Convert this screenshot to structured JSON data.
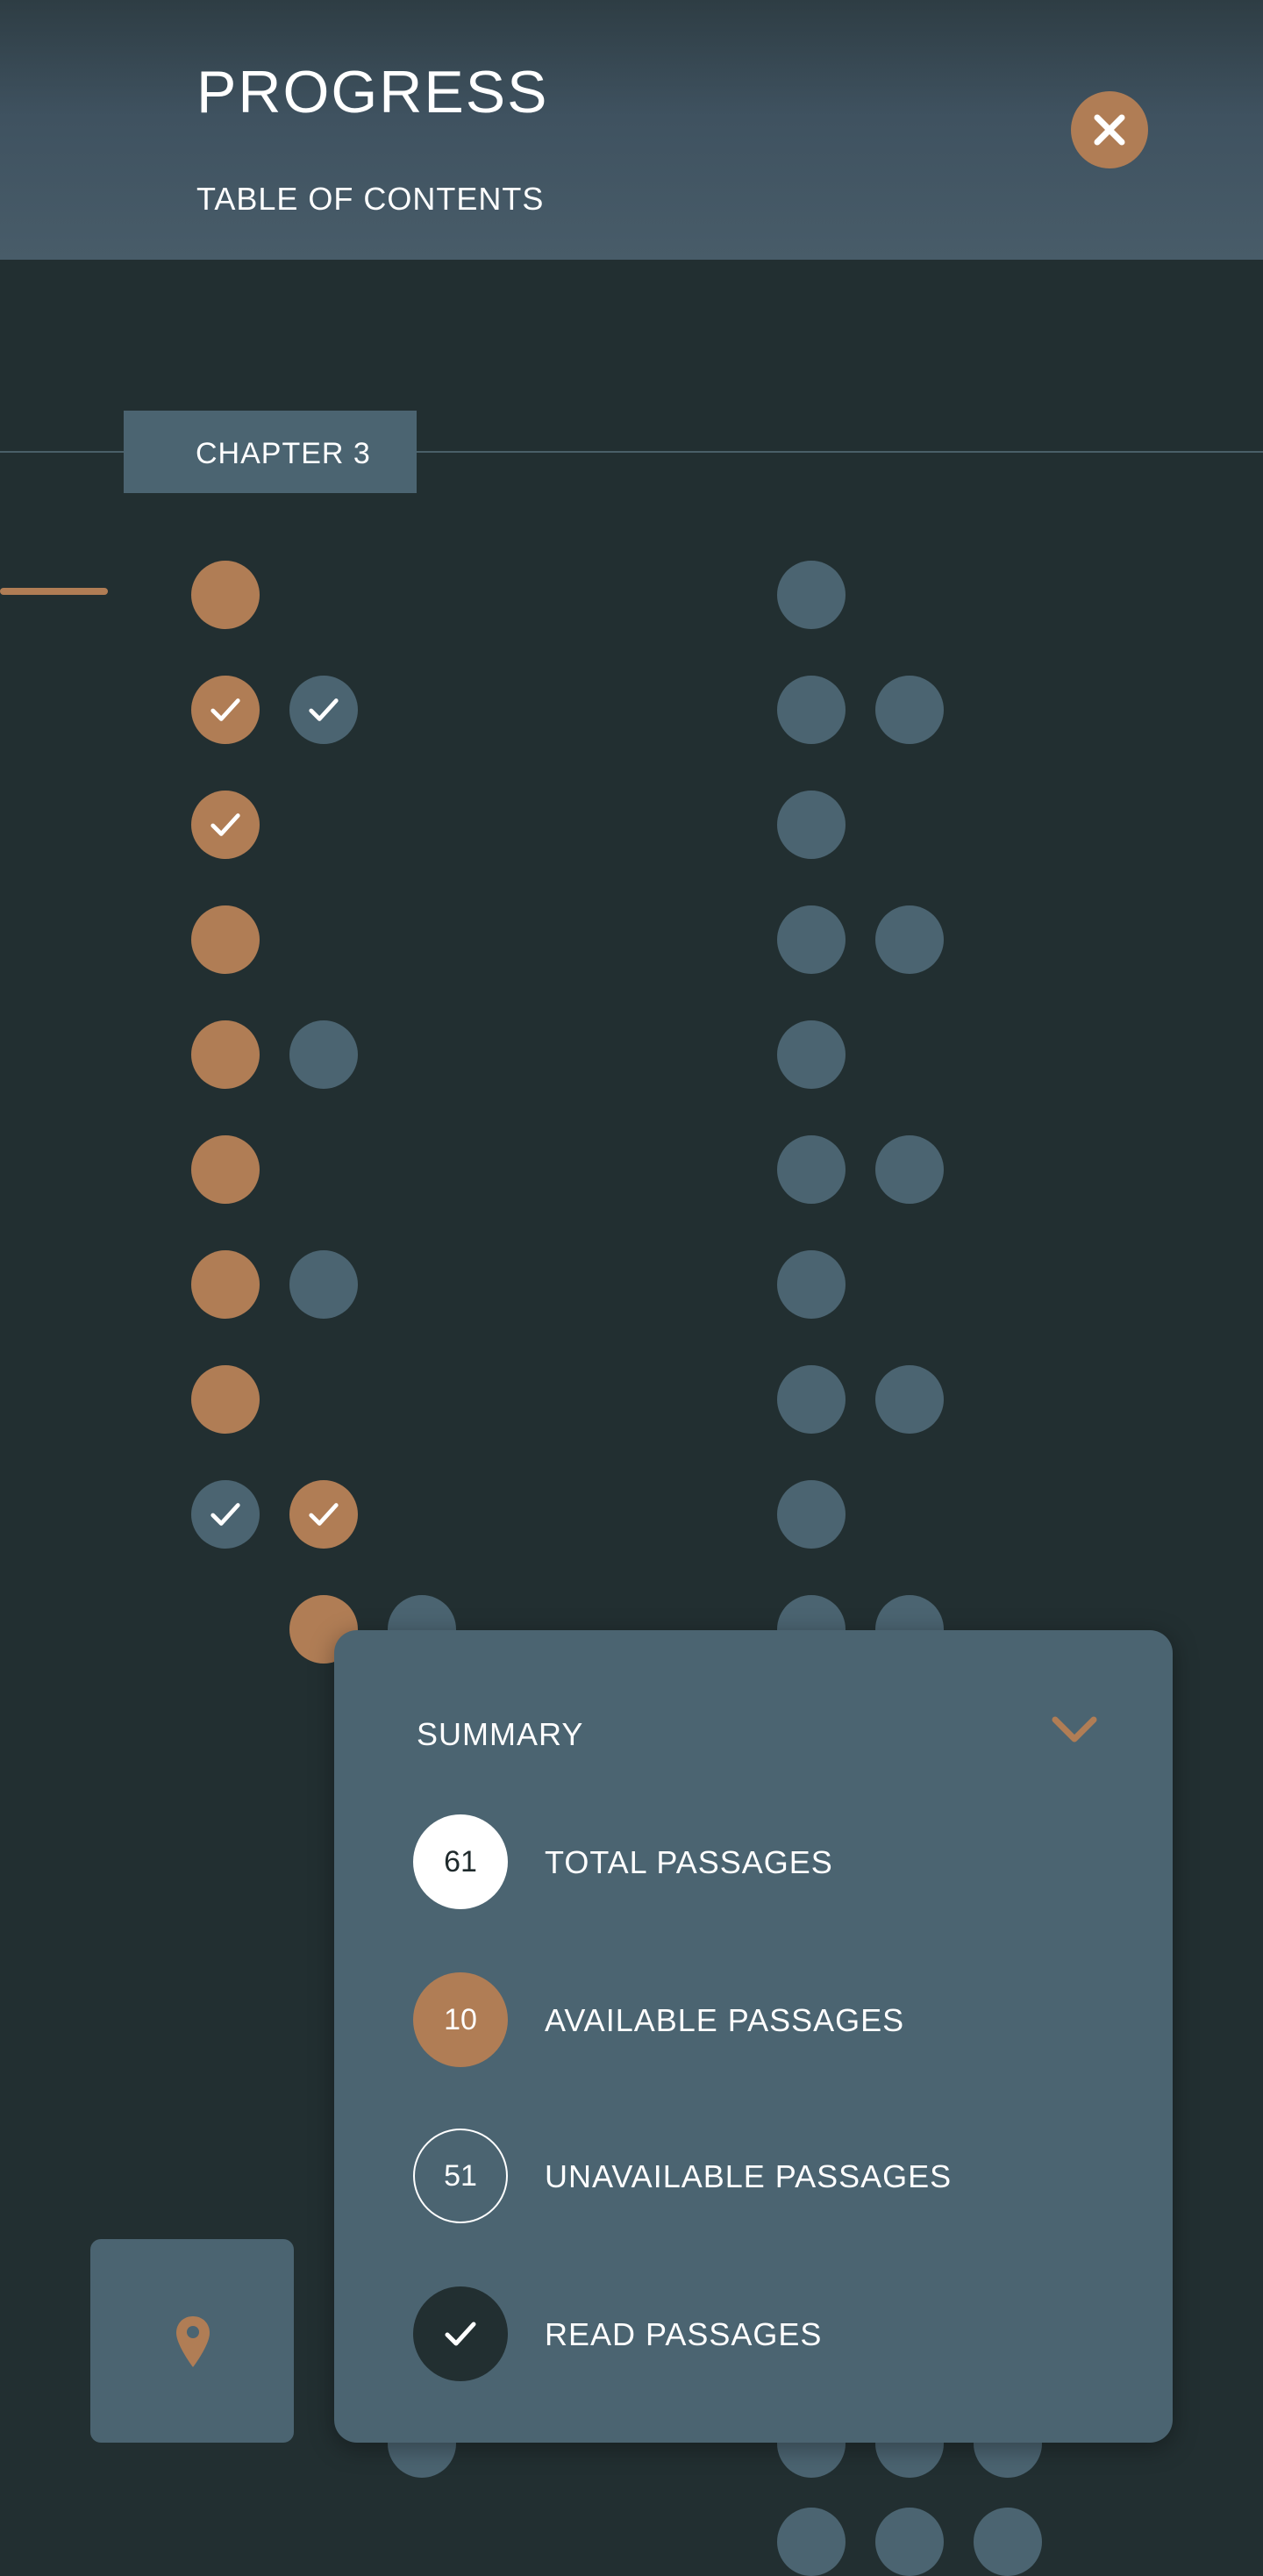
{
  "header": {
    "title": "PROGRESS",
    "subtitle": "TABLE OF CONTENTS",
    "close_icon": "close-icon"
  },
  "chapter": {
    "label": "CHAPTER 3"
  },
  "colors": {
    "background": "#222f31",
    "available": "#b07d55",
    "unavailable": "#4b6471",
    "header": "#485c69"
  },
  "passage_grid": {
    "rows": [
      {
        "left": [
          "available"
        ],
        "right": [
          "unavailable"
        ]
      },
      {
        "left": [
          "available-read",
          "unavailable-read"
        ],
        "right": [
          "unavailable",
          "unavailable"
        ]
      },
      {
        "left": [
          "available-read"
        ],
        "right": [
          "unavailable"
        ]
      },
      {
        "left": [
          "available"
        ],
        "right": [
          "unavailable",
          "unavailable"
        ]
      },
      {
        "left": [
          "available",
          "unavailable"
        ],
        "right": [
          "unavailable"
        ]
      },
      {
        "left": [
          "available"
        ],
        "right": [
          "unavailable",
          "unavailable"
        ]
      },
      {
        "left": [
          "available",
          "unavailable"
        ],
        "right": [
          "unavailable"
        ]
      },
      {
        "left": [
          "available"
        ],
        "right": [
          "unavailable",
          "unavailable"
        ]
      },
      {
        "left": [
          "unavailable-read",
          "available-read"
        ],
        "right": [
          "unavailable"
        ]
      },
      {
        "left": [
          "",
          "available",
          "unavailable"
        ],
        "right": [
          "unavailable",
          "unavailable"
        ]
      }
    ]
  },
  "summary": {
    "title": "SUMMARY",
    "collapse_icon": "chevron-down-icon",
    "total": {
      "value": "61",
      "label": "TOTAL PASSAGES"
    },
    "available": {
      "value": "10",
      "label": "AVAILABLE PASSAGES"
    },
    "unavailable": {
      "value": "51",
      "label": "UNAVAILABLE PASSAGES"
    },
    "read": {
      "label": "READ PASSAGES",
      "icon": "check-icon"
    }
  },
  "locate_button": {
    "icon": "map-pin-icon"
  }
}
